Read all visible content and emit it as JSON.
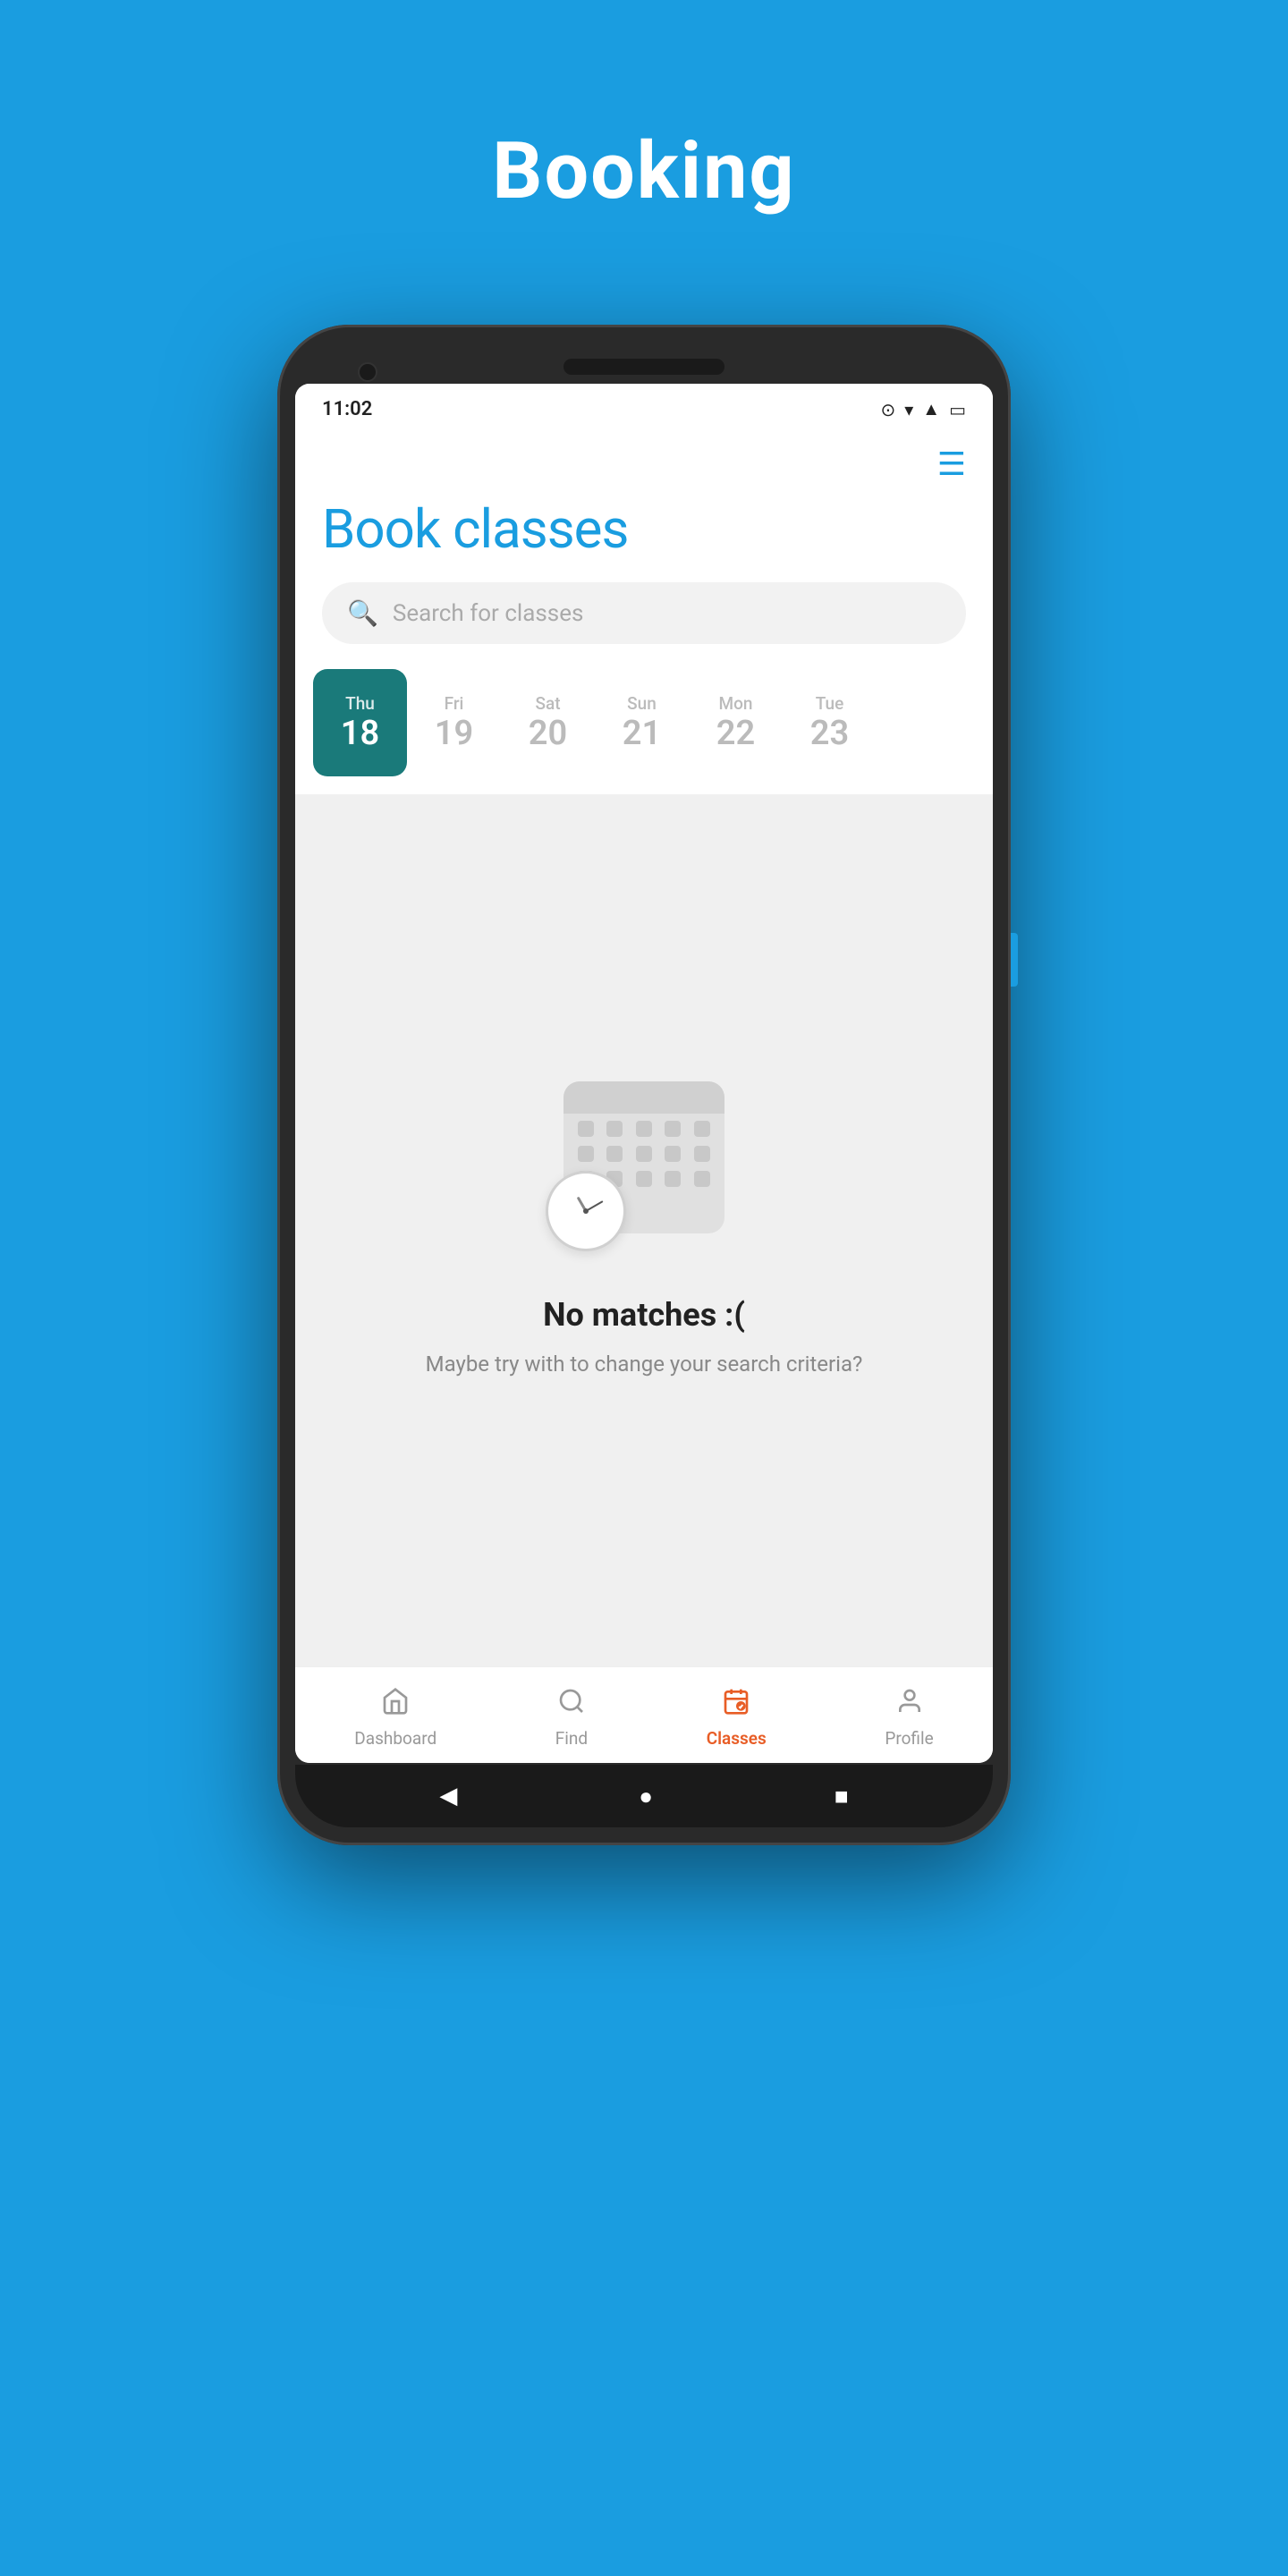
{
  "page": {
    "background_title": "Booking",
    "app": {
      "status_bar": {
        "time": "11:02"
      },
      "header": {
        "title": "Book classes"
      },
      "search": {
        "placeholder": "Search for classes"
      },
      "calendar": {
        "days": [
          {
            "name": "Thu",
            "number": "18",
            "active": true
          },
          {
            "name": "Fri",
            "number": "19",
            "active": false
          },
          {
            "name": "Sat",
            "number": "20",
            "active": false
          },
          {
            "name": "Sun",
            "number": "21",
            "active": false
          },
          {
            "name": "Mon",
            "number": "22",
            "active": false
          },
          {
            "name": "Tue",
            "number": "23",
            "active": false
          }
        ]
      },
      "empty_state": {
        "title": "No matches :(",
        "subtitle": "Maybe try with to change your search criteria?"
      },
      "bottom_nav": {
        "items": [
          {
            "id": "dashboard",
            "label": "Dashboard",
            "active": false
          },
          {
            "id": "find",
            "label": "Find",
            "active": false
          },
          {
            "id": "classes",
            "label": "Classes",
            "active": true
          },
          {
            "id": "profile",
            "label": "Profile",
            "active": false
          }
        ]
      }
    }
  }
}
